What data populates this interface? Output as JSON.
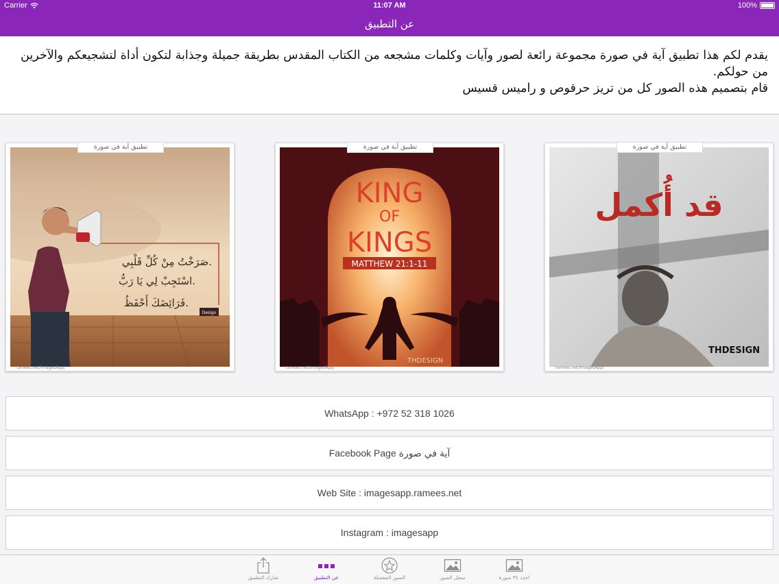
{
  "status": {
    "carrier": "Carrier",
    "time": "11:07 AM",
    "battery": "100%",
    "battery_level": 1.0
  },
  "nav": {
    "title": "عن التطبيق"
  },
  "intro": {
    "line1": "يقدم لكم هذا تطبيق آية في صورة مجموعة رائعة لصور وآيات وكلمات مشجعه من الكتاب المقدس بطريقة جميلة وجذابة لتكون أداة لتشجيعكم والآخرين من حولكم.",
    "line2": "قام بتصميم هذه الصور كل من تريز حرقوص و راميس قسيس"
  },
  "cards": [
    {
      "tag": "تطبيق آية في صورة",
      "url": "ramees.net/ImagesApp/",
      "verse1": "صَرَخْتُ مِنْ كُلِّ قَلْبِي.",
      "verse2": "اسْتَجِبْ لِي يَا رَبُّ.",
      "verse3": "فَرَائِضَكَ أَحْفَظُ.",
      "logo": "Design"
    },
    {
      "tag": "تطبيق آية في صورة",
      "url": "ramees.net/ImagesApp/",
      "headline1": "KING",
      "headline2": "OF",
      "headline3": "KINGS",
      "ribbon": "MATTHEW 21:1-11",
      "logo": "THDESIGN"
    },
    {
      "tag": "تطبيق آية في صورة",
      "url": "ramees.net/ImagesApp/",
      "headline": "قد أُكمل",
      "logo": "THDESIGN"
    }
  ],
  "links": {
    "whatsapp": "WhatsApp : +972 52 318 1026",
    "facebook": "Facebook Page آية في صورة",
    "website": "Web Site : imagesapp.ramees.net",
    "instagram": "Instagram : imagesapp"
  },
  "tabs": [
    {
      "label": "شارك التطبيق",
      "icon": "share-icon"
    },
    {
      "label": "عن التطبيق",
      "icon": "more-dots-icon",
      "active": true
    },
    {
      "label": "الصور المفضلة",
      "icon": "star-icon"
    },
    {
      "label": "سجل الصور",
      "icon": "photo-icon"
    },
    {
      "label": "اجدد ٣٤ صورة",
      "icon": "photo-icon"
    }
  ],
  "colors": {
    "brand": "#8b27b8",
    "background": "#f4f4f6",
    "tab_inactive": "#8f8f8f"
  }
}
